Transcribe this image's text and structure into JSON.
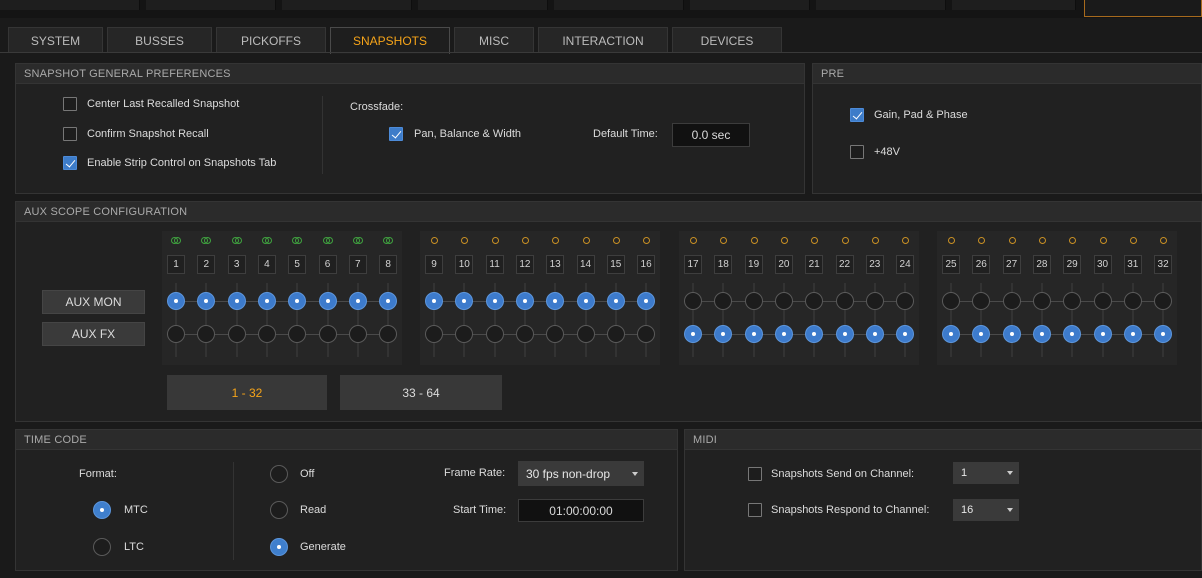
{
  "tabs": [
    {
      "label": "SYSTEM"
    },
    {
      "label": "BUSSES"
    },
    {
      "label": "PICKOFFS"
    },
    {
      "label": "SNAPSHOTS",
      "active": true
    },
    {
      "label": "MISC"
    },
    {
      "label": "INTERACTION"
    },
    {
      "label": "DEVICES"
    }
  ],
  "snapshot_prefs": {
    "title": "SNAPSHOT GENERAL PREFERENCES",
    "options": [
      {
        "label": "Center Last Recalled Snapshot",
        "checked": false
      },
      {
        "label": "Confirm Snapshot Recall",
        "checked": false
      },
      {
        "label": "Enable Strip Control on Snapshots Tab",
        "checked": true
      }
    ],
    "crossfade_label": "Crossfade:",
    "crossfade_option": {
      "label": "Pan, Balance & Width",
      "checked": true
    },
    "default_time_label": "Default Time:",
    "default_time_value": "0.0 sec"
  },
  "pre": {
    "title": "PRE",
    "options": [
      {
        "label": "Gain, Pad & Phase",
        "checked": true
      },
      {
        "label": "+48V",
        "checked": false
      }
    ]
  },
  "aux_scope": {
    "title": "AUX SCOPE CONFIGURATION",
    "rows": [
      {
        "label": "AUX MON",
        "active_channels": "1-16"
      },
      {
        "label": "AUX FX",
        "active_channels": "17-32"
      }
    ],
    "channels": [
      "1",
      "2",
      "3",
      "4",
      "5",
      "6",
      "7",
      "8",
      "9",
      "10",
      "11",
      "12",
      "13",
      "14",
      "15",
      "16",
      "17",
      "18",
      "19",
      "20",
      "21",
      "22",
      "23",
      "24",
      "25",
      "26",
      "27",
      "28",
      "29",
      "30",
      "31",
      "32"
    ],
    "linked_stereo_channels": "1-8",
    "bank_buttons": [
      {
        "label": "1 - 32",
        "active": true
      },
      {
        "label": "33 - 64",
        "active": false
      }
    ]
  },
  "time_code": {
    "title": "TIME CODE",
    "format_label": "Format:",
    "formats": [
      {
        "label": "MTC",
        "selected": true
      },
      {
        "label": "LTC",
        "selected": false
      }
    ],
    "modes": [
      {
        "label": "Off",
        "selected": false
      },
      {
        "label": "Read",
        "selected": false
      },
      {
        "label": "Generate",
        "selected": true
      }
    ],
    "frame_rate_label": "Frame Rate:",
    "frame_rate_value": "30 fps non-drop",
    "start_time_label": "Start Time:",
    "start_time_value": "01:00:00:00"
  },
  "midi": {
    "title": "MIDI",
    "options": [
      {
        "label": "Snapshots Send on Channel:",
        "checked": false,
        "channel": "1"
      },
      {
        "label": "Snapshots Respond to Channel:",
        "checked": false,
        "channel": "16"
      }
    ]
  },
  "colors": {
    "accent": "#f6a419",
    "selected_blue": "#3d7bcc",
    "link_green": "#3fa23f",
    "link_orange": "#c99024"
  }
}
